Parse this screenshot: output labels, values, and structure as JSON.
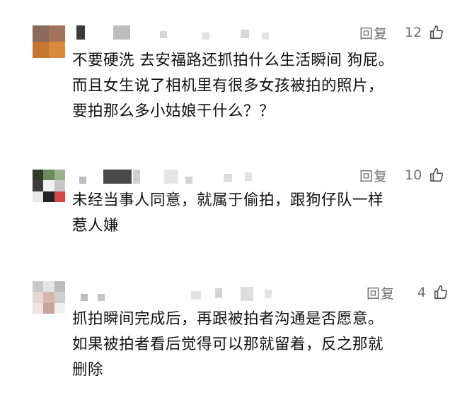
{
  "comments": [
    {
      "reply_label": "回复",
      "like_count": "12",
      "lines": [
        "不要硬洗 去安福路还抓拍什么生活瞬间 狗屁。",
        "而且女生说了相机里有很多女孩被拍的照片，",
        "要拍那么多小姑娘干什么？？"
      ]
    },
    {
      "reply_label": "回复",
      "like_count": "10",
      "lines": [
        "未经当事人同意，就属于偷拍，跟狗仔队一样",
        "惹人嫌"
      ]
    },
    {
      "reply_label": "回复",
      "like_count": "4",
      "lines": [
        "抓拍瞬间完成后，再跟被拍者沟通是否愿意。",
        "如果被拍者看后觉得可以那就留着，反之那就",
        "删除"
      ]
    }
  ],
  "icons": {
    "like": "thumbs-up-icon"
  }
}
